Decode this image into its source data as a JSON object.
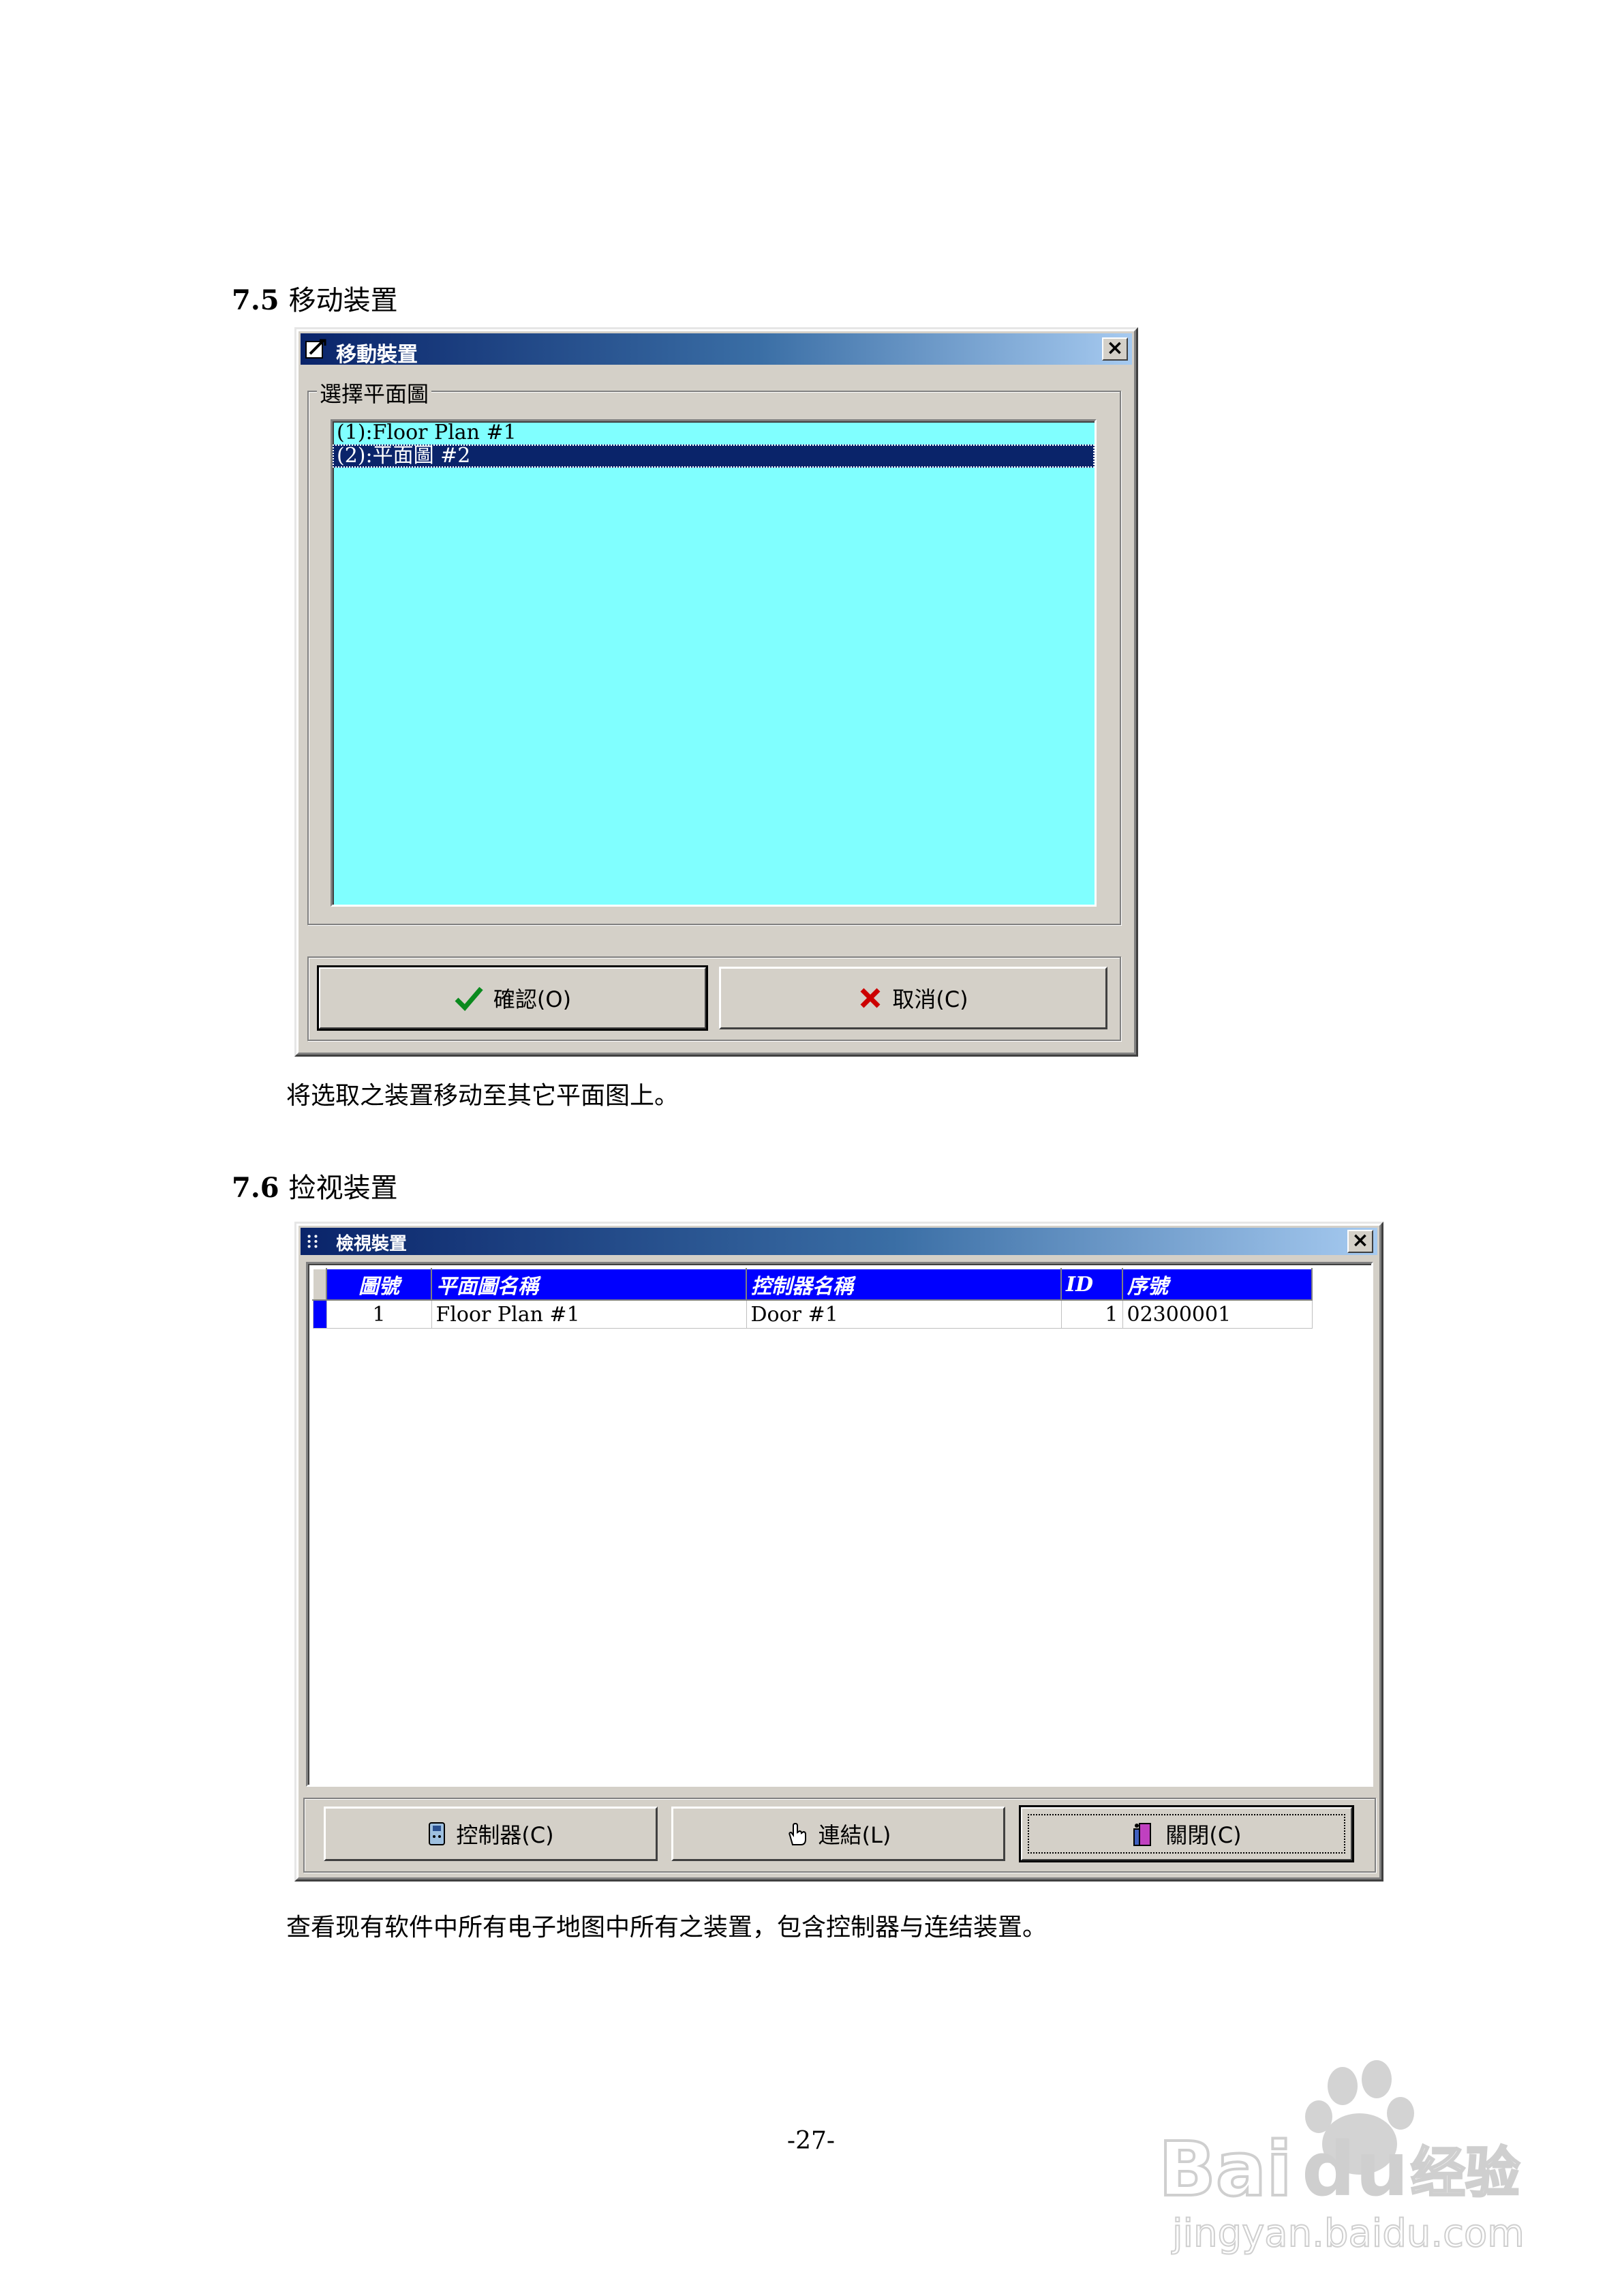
{
  "section_75": {
    "number": "7.5",
    "title": "移动装置",
    "dialog": {
      "title": "移動裝置",
      "close_label": "×",
      "group_label": "選擇平面圖",
      "items": [
        "(1):Floor Plan #1",
        "(2):平面圖 #2"
      ],
      "selected_index": 1,
      "ok_label": "確認(O)",
      "cancel_label": "取消(C)"
    },
    "description": "将选取之装置移动至其它平面图上。"
  },
  "section_76": {
    "number": "7.6",
    "title": "捡视装置",
    "dialog": {
      "title": "檢視裝置",
      "close_label": "×",
      "columns": [
        "圖號",
        "平面圖名稱",
        "控制器名稱",
        "ID",
        "序號"
      ],
      "rows": [
        {
          "map_no": "1",
          "plan_name": "Floor Plan #1",
          "controller_name": "Door #1",
          "id": "1",
          "serial": "02300001"
        }
      ],
      "controller_label": "控制器(C)",
      "link_label": "連結(L)",
      "close_button_label": "關閉(C)"
    },
    "description": "查看现有软件中所有电子地图中所有之装置，包含控制器与连结装置。"
  },
  "page_number": "-27-",
  "watermark": {
    "brand": "Baidu",
    "sub": "经验",
    "url": "jingyan.baidu.com"
  },
  "colors": {
    "list_bg": "#80ffff",
    "title_start": "#0a246a",
    "grid_header": "#0000ff"
  }
}
